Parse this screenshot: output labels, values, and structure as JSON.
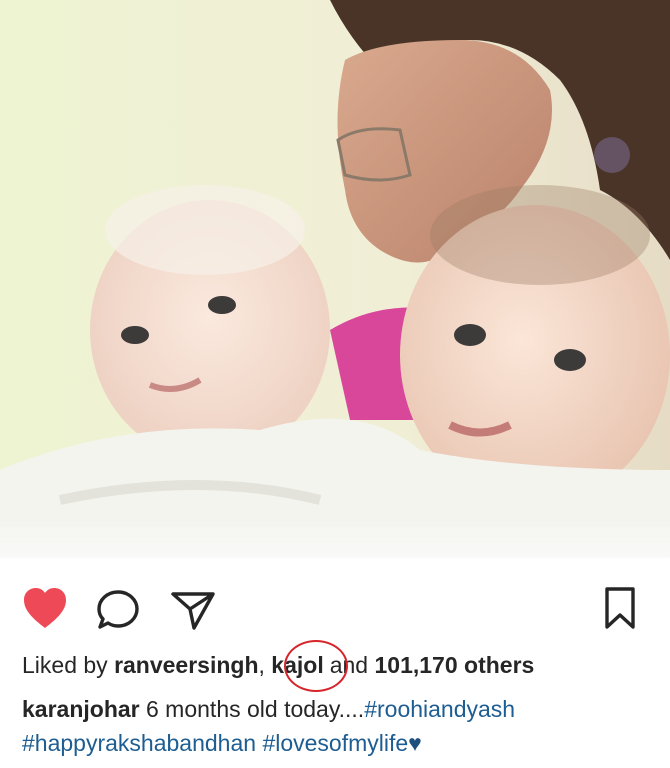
{
  "post": {
    "image_alt": "Photo of a woman smiling with two babies",
    "actions": {
      "like_icon": "heart-filled-icon",
      "comment_icon": "comment-bubble-icon",
      "share_icon": "paper-plane-icon",
      "save_icon": "bookmark-icon",
      "like_color": "#ed4956"
    },
    "likes": {
      "prefix": "Liked by ",
      "user1": "ranveersingh",
      "sep": ", ",
      "user2": "kajol",
      "middle": "and ",
      "count": "101,170 others"
    },
    "caption": {
      "username": "karanjohar",
      "text": " 6 months old today....",
      "hashtag1": "#roohiandyash",
      "hashtag2": "#happyrakshabandhan",
      "hashtag3": "#lovesofmylife",
      "emoji": "♥"
    }
  }
}
